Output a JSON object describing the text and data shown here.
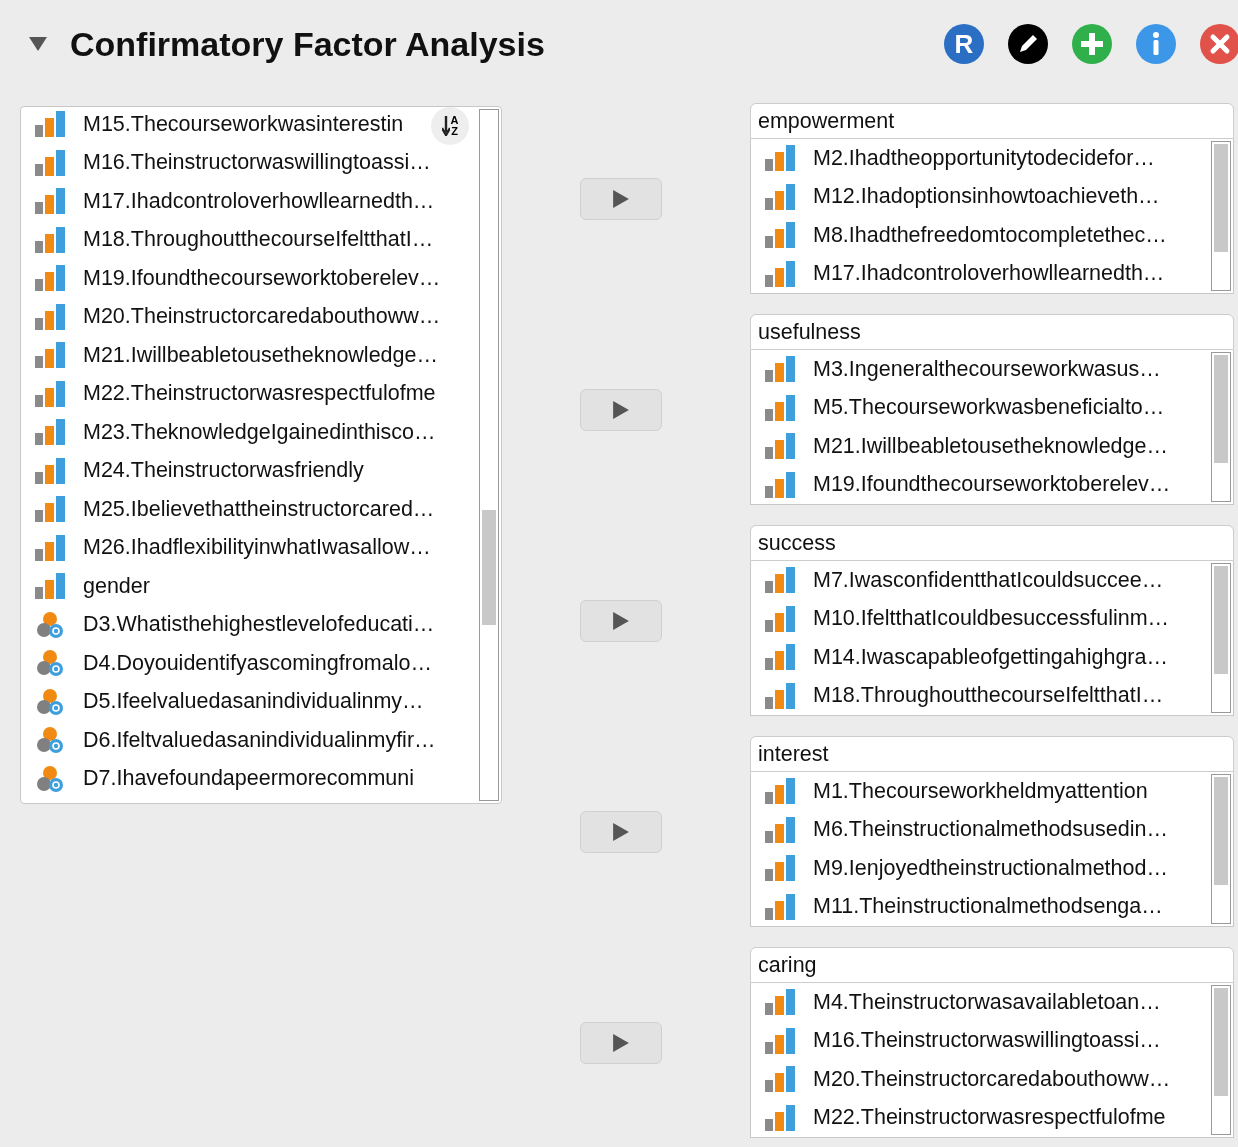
{
  "header": {
    "title": "Confirmatory Factor Analysis",
    "expanded": true
  },
  "toolbar": [
    {
      "kind": "r",
      "label": "R"
    },
    {
      "kind": "edit"
    },
    {
      "kind": "add"
    },
    {
      "kind": "info"
    },
    {
      "kind": "close"
    }
  ],
  "sort_button": {
    "letters": [
      "A",
      "Z"
    ]
  },
  "variables": [
    {
      "name": "M15.Thecourseworkwasinterestin",
      "kind": "scale"
    },
    {
      "name": "M16.Theinstructorwaswillingtoassi…",
      "kind": "scale"
    },
    {
      "name": "M17.Ihadcontroloverhowllearnedth…",
      "kind": "scale"
    },
    {
      "name": "M18.ThroughoutthecourseIfeltthatI…",
      "kind": "scale"
    },
    {
      "name": "M19.Ifoundthecourseworktoberelev…",
      "kind": "scale"
    },
    {
      "name": "M20.Theinstructorcaredabouthoww…",
      "kind": "scale"
    },
    {
      "name": "M21.Iwillbeabletousetheknowledge…",
      "kind": "scale"
    },
    {
      "name": "M22.Theinstructorwasrespectfulofme",
      "kind": "scale"
    },
    {
      "name": "M23.TheknowledgeIgainedinthisco…",
      "kind": "scale"
    },
    {
      "name": "M24.Theinstructorwasfriendly",
      "kind": "scale"
    },
    {
      "name": "M25.Ibelievethattheinstructorcared…",
      "kind": "scale"
    },
    {
      "name": "M26.IhadflexibilityinwhatIwasallow…",
      "kind": "scale"
    },
    {
      "name": "gender",
      "kind": "scale"
    },
    {
      "name": "D3.Whatisthehighestlevelofeducati…",
      "kind": "nominal"
    },
    {
      "name": "D4.Doyouidentifyascomingfromalo…",
      "kind": "nominal"
    },
    {
      "name": "D5.Ifeelvaluedasanindividualinmy…",
      "kind": "nominal"
    },
    {
      "name": "D6.Ifeltvaluedasanindividualinmyfir…",
      "kind": "nominal"
    },
    {
      "name": "D7.Ihavefoundapeermorecommuni",
      "kind": "nominal"
    }
  ],
  "factors": [
    {
      "name": "empowerment",
      "items": [
        {
          "name": "M2.Ihadtheopportunitytodecidefor…",
          "kind": "scale"
        },
        {
          "name": "M12.Ihadoptionsinhowtoachieveth…",
          "kind": "scale"
        },
        {
          "name": "M8.Ihadthefreedomtocompletethec…",
          "kind": "scale"
        },
        {
          "name": "M17.Ihadcontroloverhowllearnedth…",
          "kind": "scale"
        }
      ]
    },
    {
      "name": "usefulness",
      "items": [
        {
          "name": "M3.Ingeneralthecourseworkwasus…",
          "kind": "scale"
        },
        {
          "name": "M5.Thecourseworkwasbeneficialto…",
          "kind": "scale"
        },
        {
          "name": "M21.Iwillbeabletousetheknowledge…",
          "kind": "scale"
        },
        {
          "name": "M19.Ifoundthecourseworktoberelev…",
          "kind": "scale"
        }
      ]
    },
    {
      "name": "success",
      "items": [
        {
          "name": "M7.IwasconfidentthatIcouldsuccee…",
          "kind": "scale"
        },
        {
          "name": "M10.IfeltthatIcouldbesuccessfulinm…",
          "kind": "scale"
        },
        {
          "name": "M14.Iwascapableofgettingahighgra…",
          "kind": "scale"
        },
        {
          "name": "M18.ThroughoutthecourseIfeltthatI…",
          "kind": "scale"
        }
      ]
    },
    {
      "name": "interest",
      "items": [
        {
          "name": "M1.Thecourseworkheldmyattention",
          "kind": "scale"
        },
        {
          "name": "M6.Theinstructionalmethodsusedin…",
          "kind": "scale"
        },
        {
          "name": "M9.Ienjoyedtheinstructionalmethod…",
          "kind": "scale"
        },
        {
          "name": "M11.Theinstructionalmethodsenga…",
          "kind": "scale"
        }
      ]
    },
    {
      "name": "caring",
      "items": [
        {
          "name": "M4.Theinstructorwasavailabletoan…",
          "kind": "scale"
        },
        {
          "name": "M16.Theinstructorwaswillingtoassi…",
          "kind": "scale"
        },
        {
          "name": "M20.Theinstructorcaredabouthoww…",
          "kind": "scale"
        },
        {
          "name": "M22.Theinstructorwasrespectfulofme",
          "kind": "scale"
        }
      ]
    }
  ]
}
